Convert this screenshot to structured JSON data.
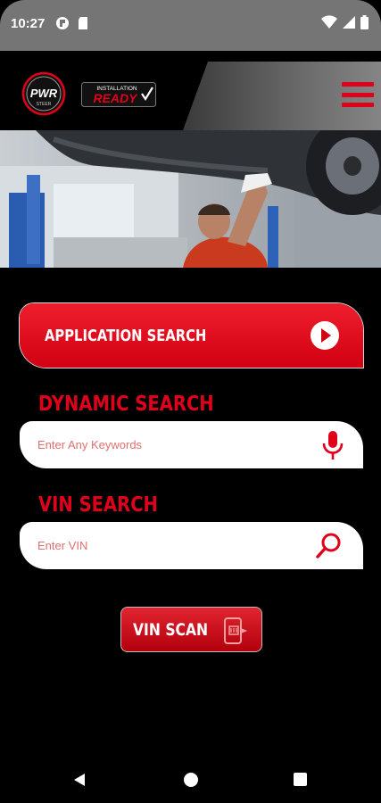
{
  "status_bar": {
    "time": "10:27",
    "left_icons": [
      "app-notification-icon",
      "sd-card-icon"
    ],
    "right_icons": [
      "wifi-icon",
      "signal-icon",
      "battery-icon"
    ]
  },
  "header": {
    "logo_primary": "PWR",
    "logo_primary_sub": "STEER",
    "logo_secondary_top": "INSTALLATION",
    "logo_secondary_main": "READY",
    "menu_icon": "hamburger-menu-icon",
    "accent_color": "#e1001a"
  },
  "hero": {
    "image": "mechanic-under-lifted-car"
  },
  "application_search": {
    "label": "APPLICATION SEARCH",
    "icon": "play-circle-icon"
  },
  "dynamic_search": {
    "title": "DYNAMIC SEARCH",
    "placeholder": "Enter Any Keywords",
    "value": "",
    "icon": "microphone-icon"
  },
  "vin_search": {
    "title": "VIN SEARCH",
    "placeholder": "Enter VIN",
    "value": "",
    "icon": "search-icon"
  },
  "vin_scan": {
    "label": "VIN SCAN",
    "icon": "barcode-scan-icon"
  },
  "nav_bar": {
    "items": [
      "back-icon",
      "home-icon",
      "recents-icon"
    ]
  }
}
